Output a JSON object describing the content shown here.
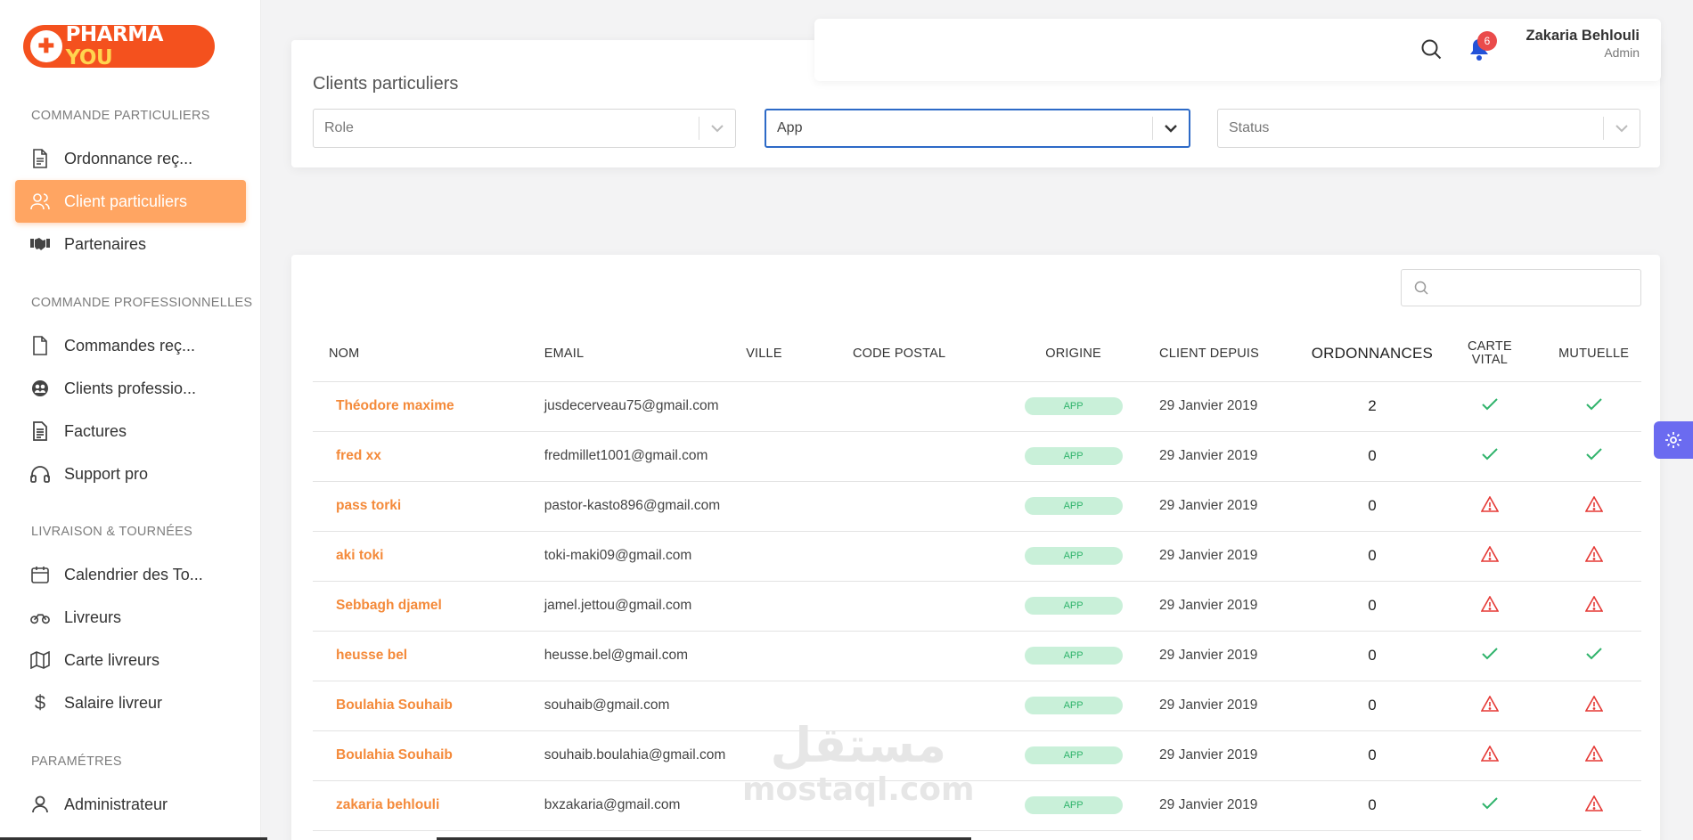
{
  "brand": {
    "logo_word_white": "PHARMA",
    "logo_word_yellow": "YOU",
    "accent": "#f4511e"
  },
  "sidebar": {
    "sections": [
      {
        "title": "COMMANDE PARTICULIERS"
      },
      {
        "title": "COMMANDE PROFESSIONNELLES"
      },
      {
        "title": "LIVRAISON & TOURNÉES"
      },
      {
        "title": "PARAMÉTRES"
      }
    ],
    "items": [
      {
        "label": "Ordonnance reç...",
        "icon": "document-icon"
      },
      {
        "label": "Client particuliers",
        "icon": "users-icon",
        "active": true
      },
      {
        "label": "Partenaires",
        "icon": "handshake-icon"
      },
      {
        "label": "Commandes reç...",
        "icon": "file-icon"
      },
      {
        "label": "Clients professio...",
        "icon": "group-icon"
      },
      {
        "label": "Factures",
        "icon": "invoice-icon"
      },
      {
        "label": "Support pro",
        "icon": "headphones-icon"
      },
      {
        "label": "Calendrier des To...",
        "icon": "calendar-icon"
      },
      {
        "label": "Livreurs",
        "icon": "motorbike-icon"
      },
      {
        "label": "Carte livreurs",
        "icon": "map-icon"
      },
      {
        "label": "Salaire livreur",
        "icon": "dollar-icon"
      },
      {
        "label": "Administrateur",
        "icon": "user-icon"
      }
    ]
  },
  "header": {
    "notification_count": "6",
    "user_name": "Zakaria Behlouli",
    "user_role": "Admin"
  },
  "filters": {
    "page_title": "Clients particuliers",
    "role": {
      "placeholder": "Role"
    },
    "app": {
      "value": "App"
    },
    "status": {
      "placeholder": "Status"
    }
  },
  "table": {
    "search_placeholder": "",
    "columns": [
      "NOM",
      "EMAIL",
      "VILLE",
      "CODE POSTAL",
      "ORIGINE",
      "CLIENT DEPUIS",
      "ORDONNANCES",
      "CARTE VITAL",
      "MUTUELLE"
    ],
    "rows": [
      {
        "nom": "Théodore maxime",
        "email": "jusdecerveau75@gmail.com",
        "ville": "",
        "cp": "",
        "origine": "APP",
        "depuis": "29 Janvier 2019",
        "ordonnances": "2",
        "carte": "ok",
        "mutuelle": "ok"
      },
      {
        "nom": "fred xx",
        "email": "fredmillet1001@gmail.com",
        "ville": "",
        "cp": "",
        "origine": "APP",
        "depuis": "29 Janvier 2019",
        "ordonnances": "0",
        "carte": "ok",
        "mutuelle": "ok"
      },
      {
        "nom": "pass torki",
        "email": "pastor-kasto896@gmail.com",
        "ville": "",
        "cp": "",
        "origine": "APP",
        "depuis": "29 Janvier 2019",
        "ordonnances": "0",
        "carte": "warn",
        "mutuelle": "warn"
      },
      {
        "nom": "aki toki",
        "email": "toki-maki09@gmail.com",
        "ville": "",
        "cp": "",
        "origine": "APP",
        "depuis": "29 Janvier 2019",
        "ordonnances": "0",
        "carte": "warn",
        "mutuelle": "warn"
      },
      {
        "nom": "Sebbagh djamel",
        "email": "jamel.jettou@gmail.com",
        "ville": "",
        "cp": "",
        "origine": "APP",
        "depuis": "29 Janvier 2019",
        "ordonnances": "0",
        "carte": "warn",
        "mutuelle": "warn"
      },
      {
        "nom": "heusse bel",
        "email": "heusse.bel@gmail.com",
        "ville": "",
        "cp": "",
        "origine": "APP",
        "depuis": "29 Janvier 2019",
        "ordonnances": "0",
        "carte": "ok",
        "mutuelle": "ok"
      },
      {
        "nom": "Boulahia Souhaib",
        "email": "souhaib@gmail.com",
        "ville": "",
        "cp": "",
        "origine": "APP",
        "depuis": "29 Janvier 2019",
        "ordonnances": "0",
        "carte": "warn",
        "mutuelle": "warn"
      },
      {
        "nom": "Boulahia Souhaib",
        "email": "souhaib.boulahia@gmail.com",
        "ville": "",
        "cp": "",
        "origine": "APP",
        "depuis": "29 Janvier 2019",
        "ordonnances": "0",
        "carte": "warn",
        "mutuelle": "warn"
      },
      {
        "nom": "zakaria behlouli",
        "email": "bxzakaria@gmail.com",
        "ville": "",
        "cp": "",
        "origine": "APP",
        "depuis": "29 Janvier 2019",
        "ordonnances": "0",
        "carte": "ok",
        "mutuelle": "warn"
      }
    ]
  },
  "watermark": {
    "arabic": "مستقل",
    "latin": "mostaql.com"
  },
  "colors": {
    "ok": "#2fb36b",
    "warn": "#e53935",
    "active_nav": "#ffa562",
    "name_link": "#f48a3a"
  }
}
